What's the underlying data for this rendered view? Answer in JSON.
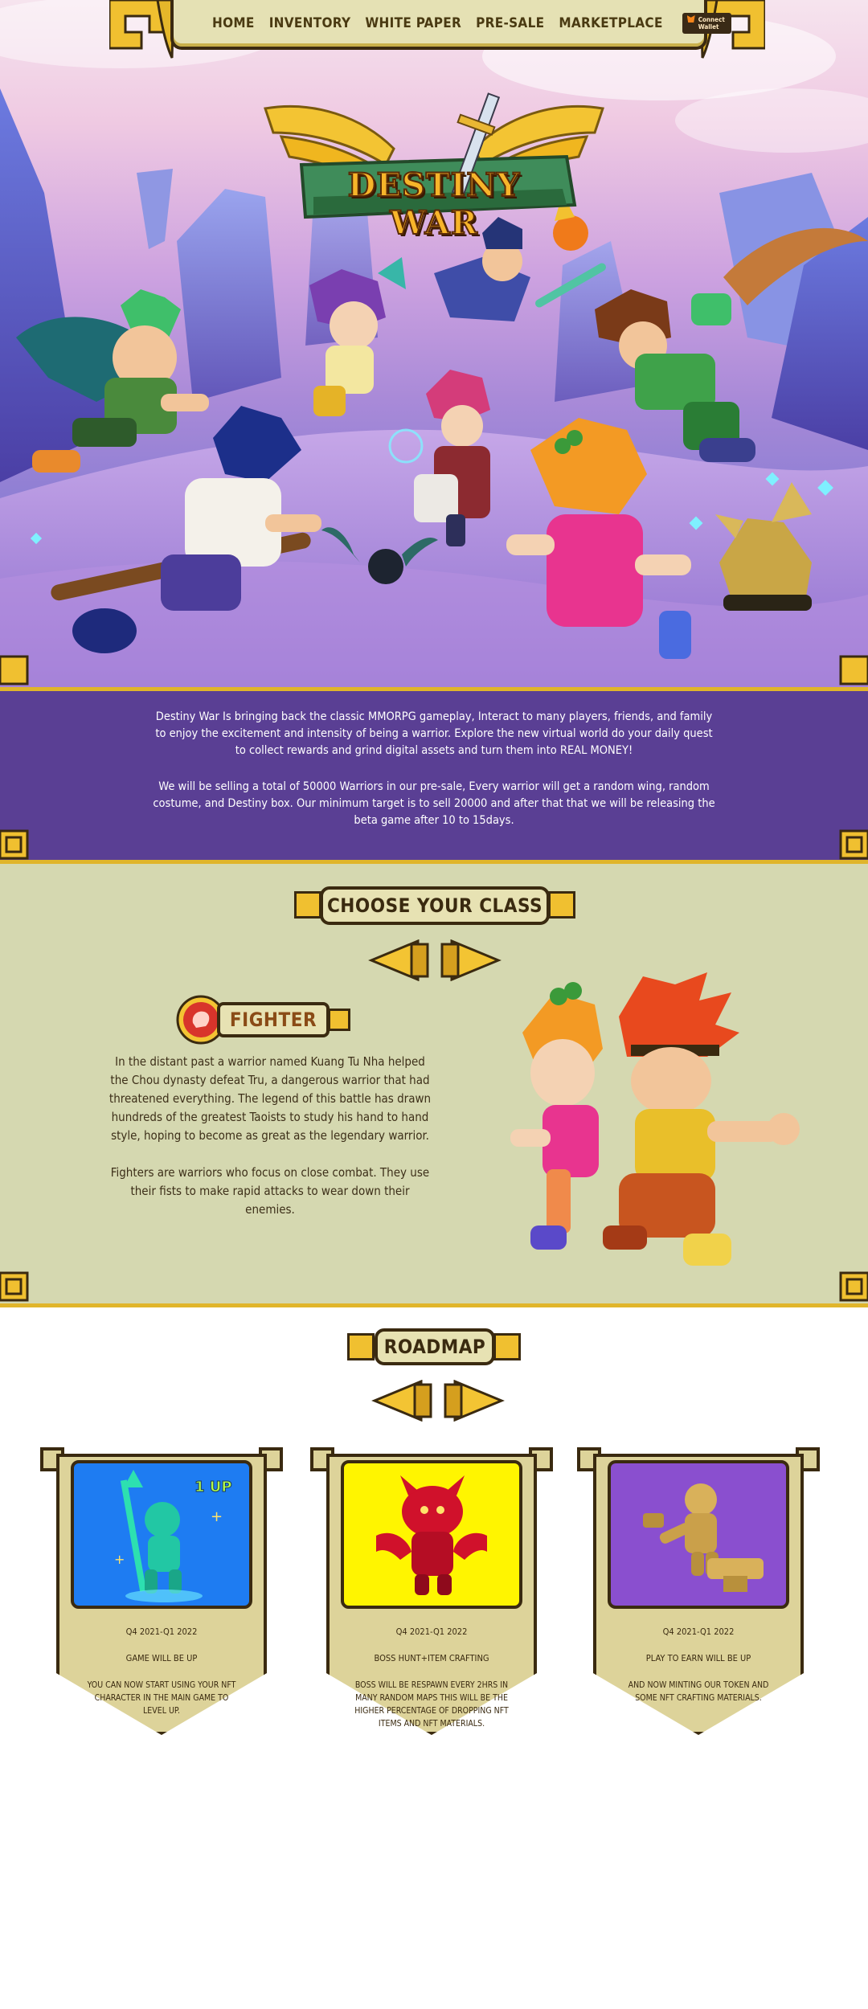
{
  "nav": {
    "items": [
      "HOME",
      "INVENTORY",
      "WHITE PAPER",
      "PRE-SALE",
      "MARKETPLACE"
    ],
    "wallet_button": "Connect Wallet"
  },
  "hero": {
    "logo_text": "DESTINY WAR"
  },
  "intro": {
    "paragraph_1": "Destiny War Is bringing back the classic MMORPG gameplay, Interact to many players, friends, and family to enjoy the excitement and intensity of being a warrior. Explore the new virtual world do your daily quest to collect rewards and grind digital assets and turn them into REAL MONEY!",
    "paragraph_2": "We will be selling a total of 50000 Warriors in our pre-sale, Every warrior will get a random wing, random costume, and Destiny box. Our minimum target is to sell 20000 and after that that we will be releasing the beta game after 10 to 15days."
  },
  "classes": {
    "heading": "CHOOSE YOUR CLASS",
    "class_name": "FIGHTER",
    "lore": "In the distant past a warrior named Kuang Tu Nha helped the Chou dynasty defeat Tru, a dangerous warrior that had threatened everything. The legend of this battle has drawn hundreds of the greatest Taoists to study his hand to hand style, hoping to become as great as the legendary warrior.",
    "description": "Fighters are warriors who focus on close combat. They use their fists to make rapid attacks to wear down their enemies."
  },
  "roadmap": {
    "heading": "ROADMAP",
    "cards": [
      {
        "date": "Q4 2021-Q1 2022",
        "title": "GAME WILL BE UP",
        "desc": "YOU CAN NOW START USING YOUR NFT CHARACTER IN THE MAIN GAME TO LEVEL UP.",
        "badge": "1 UP",
        "color": "#1e7cf2"
      },
      {
        "date": "Q4 2021-Q1 2022",
        "title": "BOSS HUNT+ITEM CRAFTING",
        "desc": "BOSS WILL BE RESPAWN EVERY 2HRS IN MANY RANDOM MAPS THIS WILL BE THE HIGHER PERCENTAGE OF DROPPING NFT ITEMS AND NFT MATERIALS.",
        "color": "#fff500"
      },
      {
        "date": "Q4 2021-Q1 2022",
        "title": "PLAY TO EARN WILL BE UP",
        "desc": "AND NOW MINTING OUR  TOKEN AND SOME NFT CRAFTING MATERIALS.",
        "color": "#8a4fcf"
      }
    ]
  },
  "colors": {
    "gold": "#e0b52b",
    "purple_band": "#5a3f94",
    "sage": "#d5d8b0",
    "ink": "#3a2a10"
  }
}
